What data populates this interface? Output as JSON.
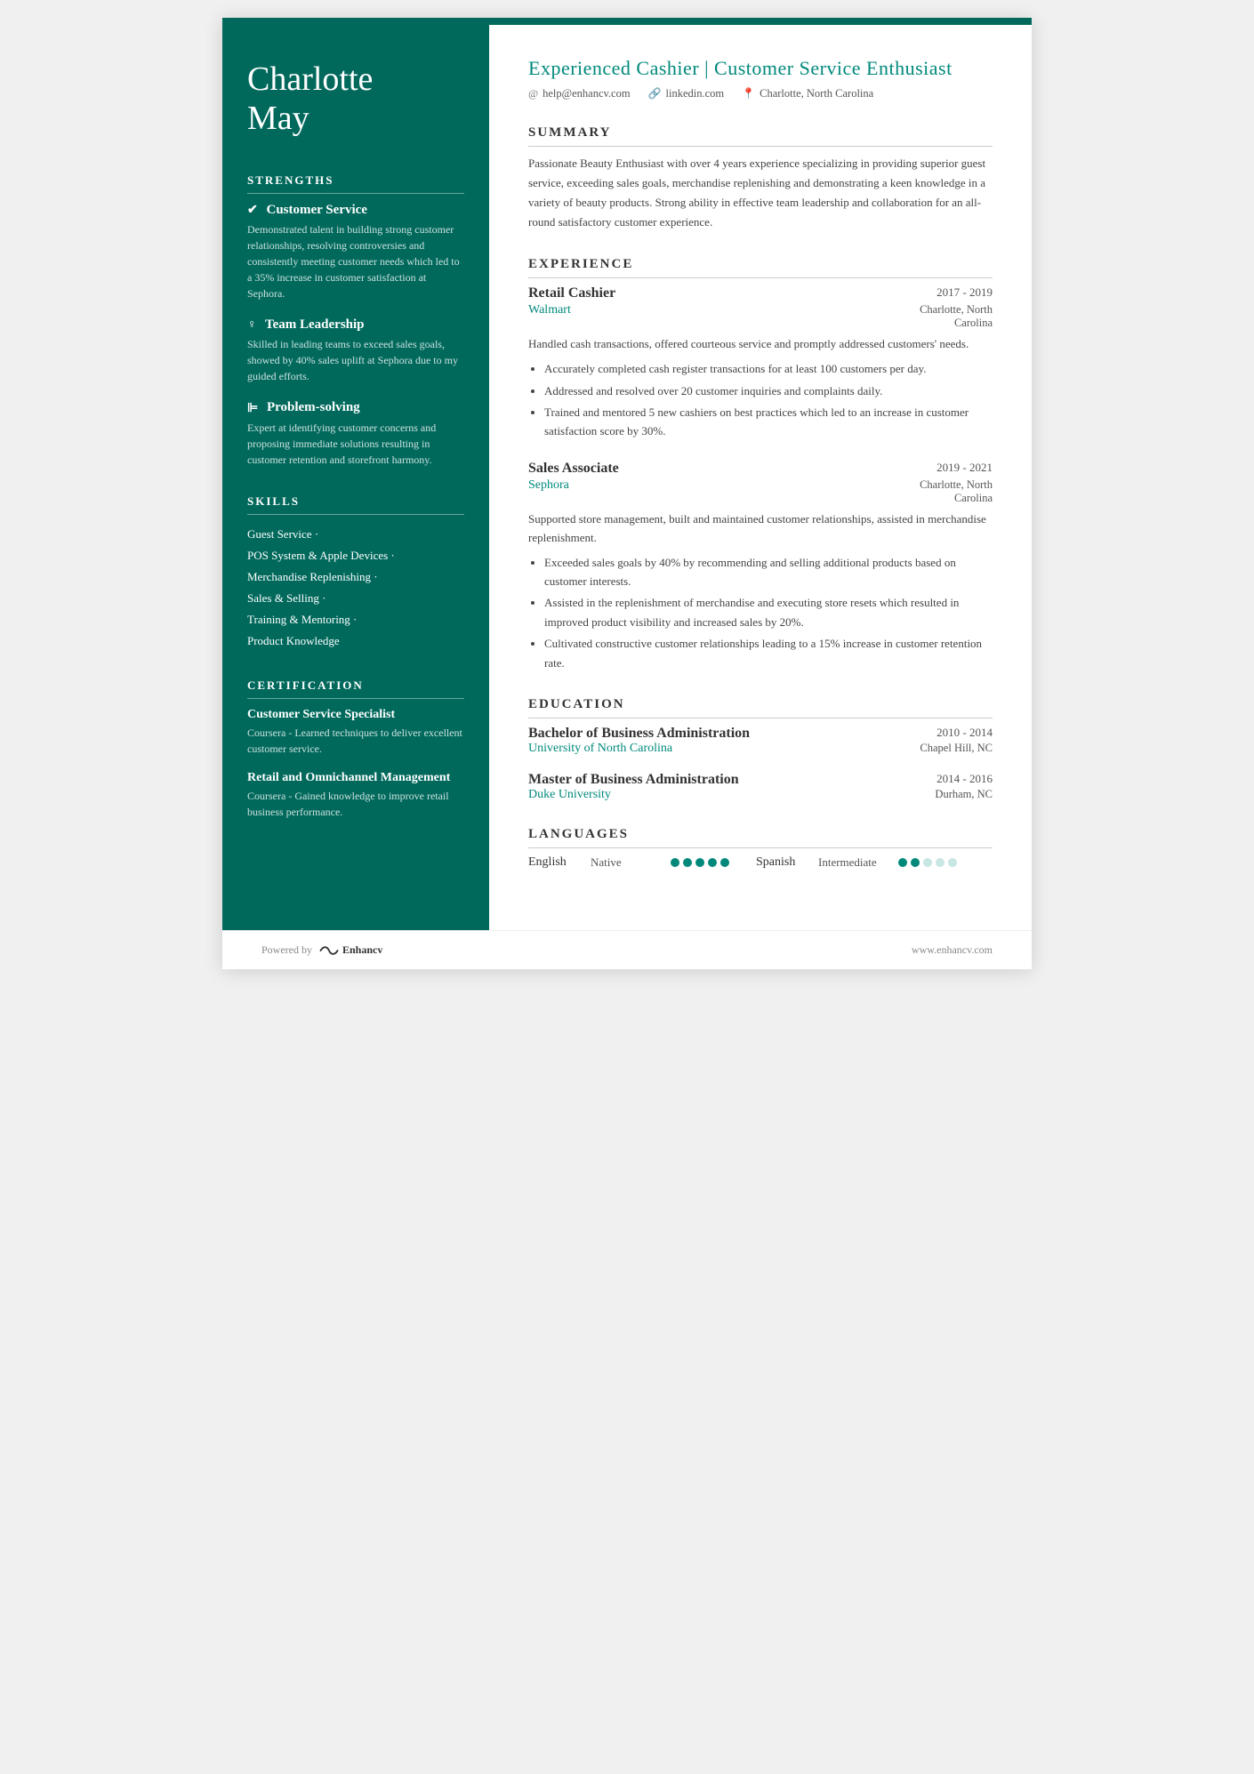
{
  "sidebar": {
    "name_line1": "Charlotte",
    "name_line2": "May",
    "strengths_title": "STRENGTHS",
    "strengths": [
      {
        "icon": "✔",
        "title": "Customer Service",
        "desc": "Demonstrated talent in building strong customer relationships, resolving controversies and consistently meeting customer needs which led to a 35% increase in customer satisfaction at Sephora."
      },
      {
        "icon": "♀",
        "title": "Team Leadership",
        "desc": "Skilled in leading teams to exceed sales goals, showed by 40% sales uplift at Sephora due to my guided efforts."
      },
      {
        "icon": "⊫",
        "title": "Problem-solving",
        "desc": "Expert at identifying customer concerns and proposing immediate solutions resulting in customer retention and storefront harmony."
      }
    ],
    "skills_title": "SKILLS",
    "skills": [
      {
        "label": "Guest Service ·"
      },
      {
        "label": "POS System & Apple Devices ·"
      },
      {
        "label": "Merchandise Replenishing ·"
      },
      {
        "label": "Sales & Selling ·"
      },
      {
        "label": "Training & Mentoring ·"
      },
      {
        "label": "Product Knowledge"
      }
    ],
    "certification_title": "CERTIFICATION",
    "certifications": [
      {
        "title": "Customer Service Specialist",
        "desc": "Coursera - Learned techniques to deliver excellent customer service."
      },
      {
        "title": "Retail and Omnichannel Management",
        "desc": "Coursera - Gained knowledge to improve retail business performance."
      }
    ]
  },
  "header": {
    "title": "Experienced Cashier | Customer Service Enthusiast",
    "contact": {
      "email": "help@enhancv.com",
      "linkedin": "linkedin.com",
      "location": "Charlotte, North Carolina"
    }
  },
  "summary": {
    "title": "SUMMARY",
    "text": "Passionate Beauty Enthusiast with over 4 years experience specializing in providing superior guest service, exceeding sales goals, merchandise replenishing and demonstrating a keen knowledge in a variety of beauty products. Strong ability in effective team leadership and collaboration for an all-round satisfactory customer experience."
  },
  "experience": {
    "title": "EXPERIENCE",
    "items": [
      {
        "role": "Retail Cashier",
        "dates": "2017 - 2019",
        "company": "Walmart",
        "location": "Charlotte, North\nCarolina",
        "desc": "Handled cash transactions, offered courteous service and promptly addressed customers' needs.",
        "bullets": [
          "Accurately completed cash register transactions for at least 100 customers per day.",
          "Addressed and resolved over 20 customer inquiries and complaints daily.",
          "Trained and mentored 5 new cashiers on best practices which led to an increase in customer satisfaction score by 30%."
        ]
      },
      {
        "role": "Sales Associate",
        "dates": "2019 - 2021",
        "company": "Sephora",
        "location": "Charlotte, North\nCarolina",
        "desc": "Supported store management, built and maintained customer relationships, assisted in merchandise replenishment.",
        "bullets": [
          "Exceeded sales goals by 40% by recommending and selling additional products based on customer interests.",
          "Assisted in the replenishment of merchandise and executing store resets which resulted in improved product visibility and increased sales by 20%.",
          "Cultivated constructive customer relationships leading to a 15% increase in customer retention rate."
        ]
      }
    ]
  },
  "education": {
    "title": "EDUCATION",
    "items": [
      {
        "degree": "Bachelor of Business Administration",
        "dates": "2010 - 2014",
        "school": "University of North Carolina",
        "location": "Chapel Hill, NC"
      },
      {
        "degree": "Master of Business Administration",
        "dates": "2014 - 2016",
        "school": "Duke University",
        "location": "Durham, NC"
      }
    ]
  },
  "languages": {
    "title": "LANGUAGES",
    "items": [
      {
        "name": "English",
        "level": "Native",
        "filled": 5,
        "total": 5
      },
      {
        "name": "Spanish",
        "level": "Intermediate",
        "filled": 2,
        "total": 5
      }
    ]
  },
  "footer": {
    "powered_by": "Powered by",
    "brand": "Enhancv",
    "website": "www.enhancv.com"
  }
}
